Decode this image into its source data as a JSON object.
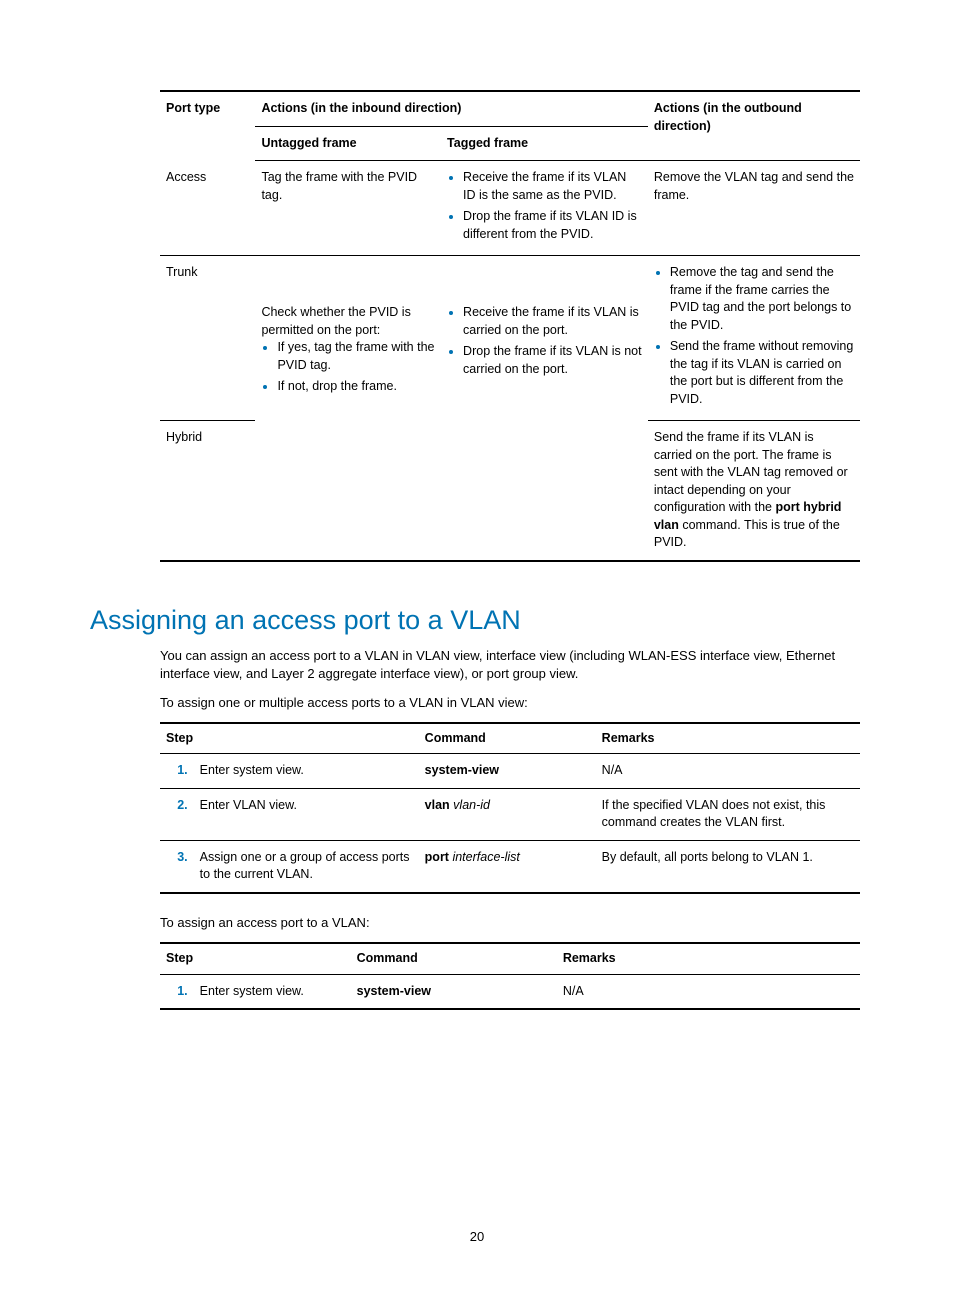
{
  "page_number": "20",
  "table1": {
    "header": {
      "port_type": "Port type",
      "actions_in": "Actions (in the inbound direction)",
      "untagged": "Untagged frame",
      "tagged": "Tagged frame",
      "actions_out_l1": "Actions (in the outbound",
      "actions_out_l2": "direction)"
    },
    "rows": {
      "access": {
        "port_type": "Access",
        "untagged": "Tag the frame with the PVID tag.",
        "tagged": {
          "b1": "Receive the frame if its VLAN ID is the same as the PVID.",
          "b2": "Drop the frame if its VLAN ID is different from the PVID."
        },
        "outbound": "Remove the VLAN tag and send the frame."
      },
      "trunk": {
        "port_type": "Trunk",
        "out_b1": "Remove the tag and send the frame if the frame carries the PVID tag and the port belongs to the PVID.",
        "out_b2": "Send the frame without removing the tag if its VLAN is carried on the port but is different from the PVID."
      },
      "shared_in": {
        "untagged_lead": "Check whether the PVID is permitted on the port:",
        "untagged_b1": "If yes, tag the frame with the PVID tag.",
        "untagged_b2": "If not, drop the frame.",
        "tagged_b1": "Receive the frame if its VLAN is carried on the port.",
        "tagged_b2": "Drop the frame if its VLAN is not carried on the port."
      },
      "hybrid": {
        "port_type": "Hybrid",
        "out_p1": "Send the frame if its VLAN is carried on the port. The frame is sent with the VLAN tag removed or intact depending on your configuration with the ",
        "out_bold": "port hybrid vlan",
        "out_p2": " command. This is true of the PVID."
      }
    }
  },
  "assign": {
    "heading": "Assigning an access port to a VLAN",
    "intro": "You can assign an access port to a VLAN in VLAN view, interface view (including WLAN-ESS interface view, Ethernet interface view, and Layer 2 aggregate interface view), or port group view.",
    "lead_multi": "To assign one or multiple access ports to a VLAN in VLAN view:",
    "tableA": {
      "head": {
        "step": "Step",
        "cmd": "Command",
        "rem": "Remarks"
      },
      "r1": {
        "n": "1.",
        "step": "Enter system view.",
        "cmd_b": "system-view",
        "rem": "N/A"
      },
      "r2": {
        "n": "2.",
        "step": "Enter VLAN view.",
        "cmd_b": "vlan",
        "cmd_i": " vlan-id",
        "rem": "If the specified VLAN does not exist, this command creates the VLAN first."
      },
      "r3": {
        "n": "3.",
        "step": "Assign one or a group of access ports to the current VLAN.",
        "cmd_b": "port",
        "cmd_i": " interface-list",
        "rem": "By default, all ports belong to VLAN 1."
      }
    },
    "lead_single": "To assign an access port to a VLAN:",
    "tableB": {
      "head": {
        "step": "Step",
        "cmd": "Command",
        "rem": "Remarks"
      },
      "r1": {
        "n": "1.",
        "step": "Enter system view.",
        "cmd_b": "system-view",
        "rem": "N/A"
      }
    }
  }
}
